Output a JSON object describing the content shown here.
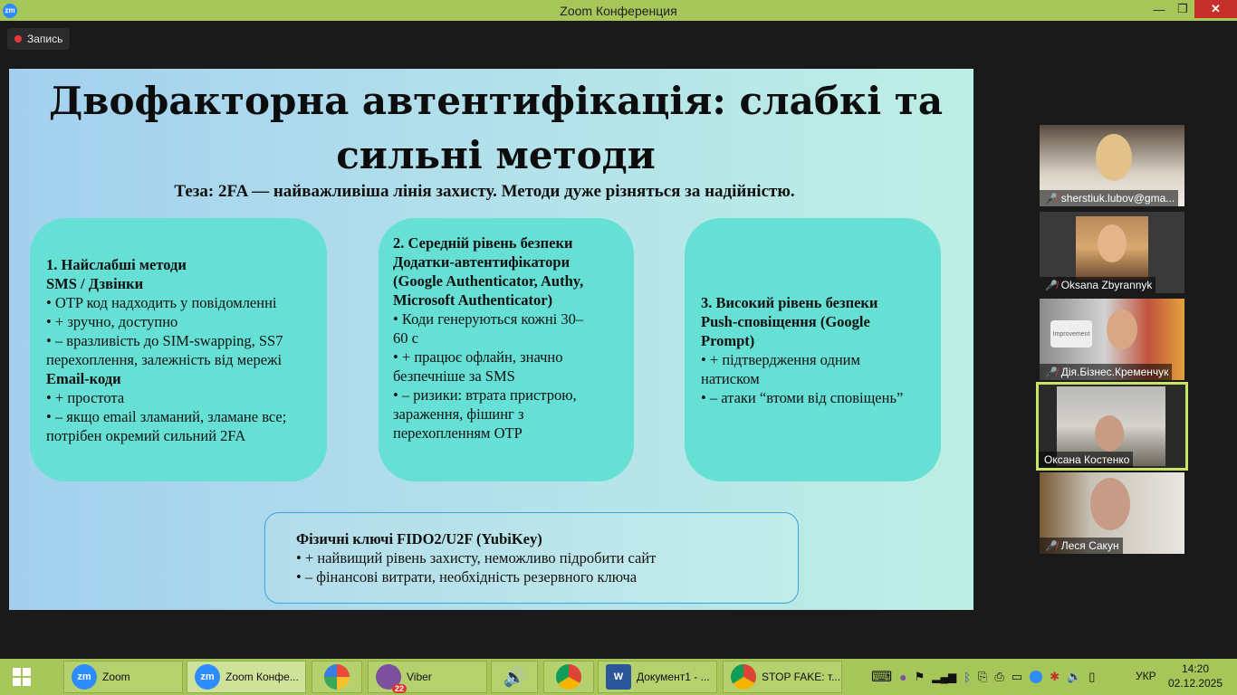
{
  "window": {
    "title": "Zoom Конференция",
    "logo": "zm",
    "minimize": "—",
    "maximize": "❐",
    "close": "✕"
  },
  "recording": {
    "label": "Запись"
  },
  "slide": {
    "title_line1": "Двофакторна автентифікація: слабкі та",
    "title_line2": "сильні методи",
    "thesis": "Теза: 2FA — найважливіша лінія захисту. Методи дуже різняться за надійністю.",
    "box1": {
      "l1": "1. Найслабші методи",
      "l2": "SMS / Дзвінки",
      "l3": "• OTP код надходить у повідомленні",
      "l4": "• + зручно, доступно",
      "l5": "• – вразливість до SIM-swapping, SS7",
      "l6": "перехоплення, залежність від мережі",
      "l7": "Email-коди",
      "l8": "• + простота",
      "l9": "• – якщо email зламаний, зламане все;",
      "l10": "потрібен окремий сильний 2FA"
    },
    "box2": {
      "l1": "2. Середній рівень безпеки",
      "l2": "Додатки-автентифікатори",
      "l3": "(Google Authenticator, Authy,",
      "l4": "Microsoft Authenticator)",
      "l5": "• Коди генеруються кожні 30–",
      "l6": "60 с",
      "l7": "• + працює офлайн, значно",
      "l8": "безпечніше за SMS",
      "l9": "• – ризики: втрата пристрою,",
      "l10": "зараження, фішинг з",
      "l11": "перехопленням OTP"
    },
    "box3": {
      "l1": "3. Високий рівень безпеки",
      "l2": "Push-сповіщення (Google",
      "l3": "Prompt)",
      "l4": "• + підтвердження одним",
      "l5": "натиском",
      "l6": "• – атаки “втоми від сповіщень”"
    },
    "box4": {
      "l1": "Фізичні ключі FIDO2/U2F (YubiKey)",
      "l2": "• + найвищий рівень захисту, неможливо підробити сайт",
      "l3": "• – фінансові витрати, необхідність резервного ключа"
    }
  },
  "participants": [
    {
      "name": "sherstiuk.lubov@gma...",
      "muted": true
    },
    {
      "name": "Oksana Zbyrannyk",
      "muted": true
    },
    {
      "name": "Дія.Бізнес.Кременчук",
      "muted": true
    },
    {
      "name": "Оксана Костенко",
      "muted": false,
      "active": true
    },
    {
      "name": "Леся Сакун",
      "muted": true
    }
  ],
  "participant_sign": "Improvement",
  "taskbar": {
    "apps": [
      {
        "label": "Zoom",
        "icon": "zm"
      },
      {
        "label": "Zoom Конфе...",
        "icon": "zm"
      },
      {
        "label": "Viber",
        "badge": "22"
      },
      {
        "label": "Документ1 - ...",
        "icon": "W"
      },
      {
        "label": "STOP FAKE: т..."
      }
    ],
    "lang": "УКР",
    "time": "14:20",
    "date": "02.12.2025"
  },
  "colors": {
    "accent_green": "#a6c659",
    "box_teal": "#66dfd5",
    "zoom_blue": "#2d8cff",
    "record_red": "#e8383b",
    "active_outline": "#c9e268"
  }
}
